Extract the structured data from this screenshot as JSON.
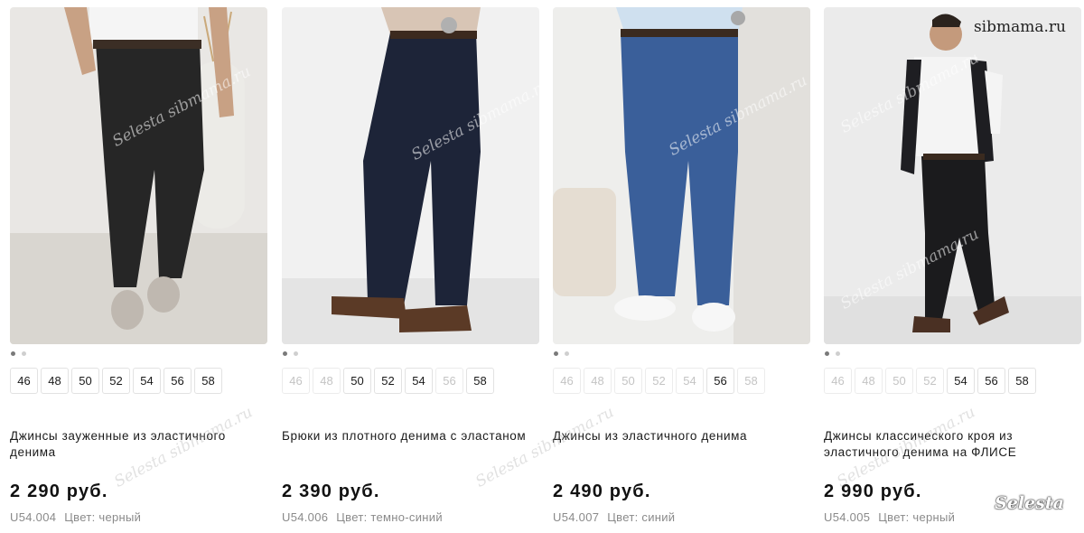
{
  "watermark": {
    "site": "sibmama.ru",
    "overlay": "Selesta sibmama.ru",
    "brand": "Selesta"
  },
  "products": [
    {
      "title": "Джинсы зауженные из эластичного денима",
      "price": "2 290 руб.",
      "sku": "U54.004",
      "color_text": "Цвет: черный",
      "sizes": [
        {
          "label": "46",
          "available": true
        },
        {
          "label": "48",
          "available": true
        },
        {
          "label": "50",
          "available": true
        },
        {
          "label": "52",
          "available": true
        },
        {
          "label": "54",
          "available": true
        },
        {
          "label": "56",
          "available": true
        },
        {
          "label": "58",
          "available": true
        }
      ]
    },
    {
      "title": "Брюки из плотного денима с эластаном",
      "price": "2 390 руб.",
      "sku": "U54.006",
      "color_text": "Цвет: темно-синий",
      "sizes": [
        {
          "label": "46",
          "available": false
        },
        {
          "label": "48",
          "available": false
        },
        {
          "label": "50",
          "available": true
        },
        {
          "label": "52",
          "available": true
        },
        {
          "label": "54",
          "available": true
        },
        {
          "label": "56",
          "available": false
        },
        {
          "label": "58",
          "available": true
        }
      ]
    },
    {
      "title": "Джинсы из эластичного денима",
      "price": "2 490 руб.",
      "sku": "U54.007",
      "color_text": "Цвет: синий",
      "sizes": [
        {
          "label": "46",
          "available": false
        },
        {
          "label": "48",
          "available": false
        },
        {
          "label": "50",
          "available": false
        },
        {
          "label": "52",
          "available": false
        },
        {
          "label": "54",
          "available": false
        },
        {
          "label": "56",
          "available": true
        },
        {
          "label": "58",
          "available": false
        }
      ]
    },
    {
      "title": "Джинсы классического кроя из эластичного денима на ФЛИСЕ",
      "price": "2 990 руб.",
      "sku": "U54.005",
      "color_text": "Цвет: черный",
      "sizes": [
        {
          "label": "46",
          "available": false
        },
        {
          "label": "48",
          "available": false
        },
        {
          "label": "50",
          "available": false
        },
        {
          "label": "52",
          "available": false
        },
        {
          "label": "54",
          "available": true
        },
        {
          "label": "56",
          "available": true
        },
        {
          "label": "58",
          "available": true
        }
      ]
    }
  ]
}
